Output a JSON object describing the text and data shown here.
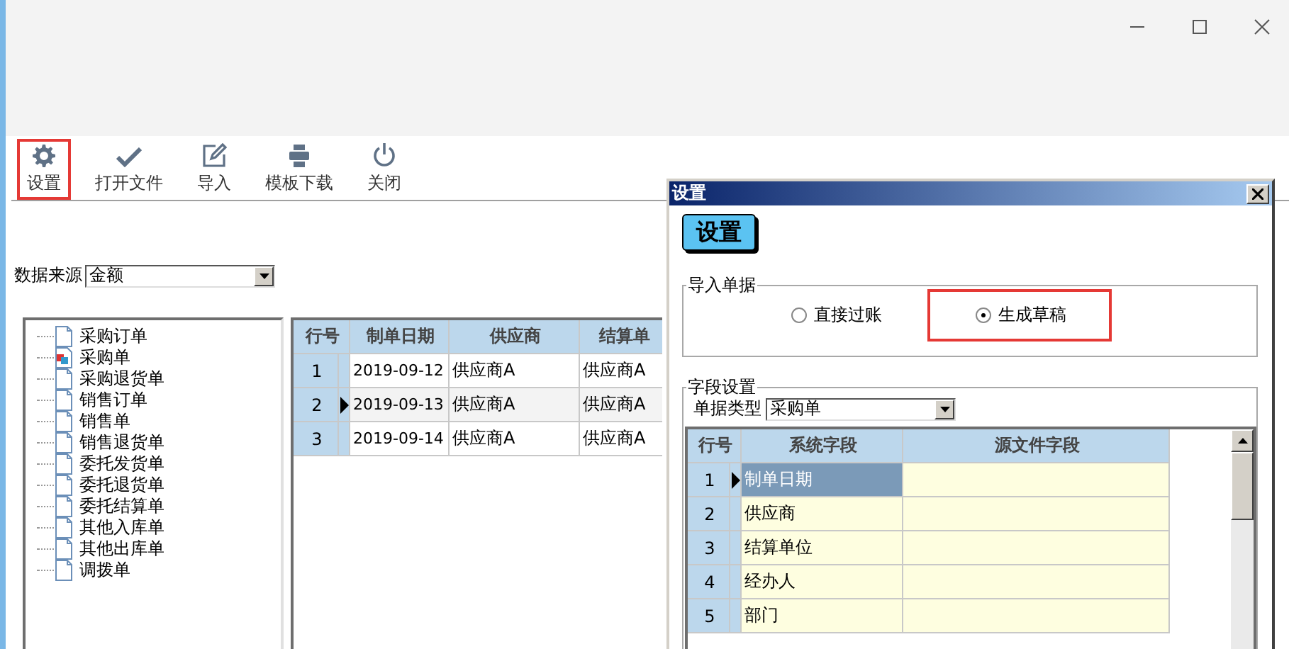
{
  "toolbar": [
    {
      "label": "设置",
      "selected": true
    },
    {
      "label": "打开文件",
      "selected": false
    },
    {
      "label": "导入",
      "selected": false
    },
    {
      "label": "模板下载",
      "selected": false
    },
    {
      "label": "关闭",
      "selected": false
    }
  ],
  "data_source": {
    "label": "数据来源",
    "value": "金额"
  },
  "tree": [
    {
      "label": "采购订单",
      "selected": false
    },
    {
      "label": "采购单",
      "selected": true
    },
    {
      "label": "采购退货单",
      "selected": false
    },
    {
      "label": "销售订单",
      "selected": false
    },
    {
      "label": "销售单",
      "selected": false
    },
    {
      "label": "销售退货单",
      "selected": false
    },
    {
      "label": "委托发货单",
      "selected": false
    },
    {
      "label": "委托退货单",
      "selected": false
    },
    {
      "label": "委托结算单",
      "selected": false
    },
    {
      "label": "其他入库单",
      "selected": false
    },
    {
      "label": "其他出库单",
      "selected": false
    },
    {
      "label": "调拨单",
      "selected": false
    }
  ],
  "grid": {
    "columns": [
      "行号",
      "制单日期",
      "供应商",
      "结算单"
    ],
    "rows": [
      {
        "cells": [
          "1",
          "2019-09-12",
          "供应商A",
          "供应商A"
        ],
        "current": false
      },
      {
        "cells": [
          "2",
          "2019-09-13",
          "供应商A",
          "供应商A"
        ],
        "current": true
      },
      {
        "cells": [
          "3",
          "2019-09-14",
          "供应商A",
          "供应商A"
        ],
        "current": false
      }
    ]
  },
  "dialog": {
    "title": "设置",
    "header_button": "设置",
    "import_group": {
      "title": "导入单据",
      "options": [
        {
          "label": "直接过账",
          "selected": false
        },
        {
          "label": "生成草稿",
          "selected": true
        }
      ]
    },
    "field_group": {
      "title": "字段设置",
      "type_label": "单据类型",
      "type_value": "采购单",
      "columns": [
        "行号",
        "系统字段",
        "源文件字段"
      ],
      "rows": [
        {
          "number": "1",
          "system": "制单日期",
          "current": true
        },
        {
          "number": "2",
          "system": "供应商",
          "current": false
        },
        {
          "number": "3",
          "system": "结算单位",
          "current": false
        },
        {
          "number": "4",
          "system": "经办人",
          "current": false
        },
        {
          "number": "5",
          "system": "部门",
          "current": false
        }
      ]
    }
  }
}
